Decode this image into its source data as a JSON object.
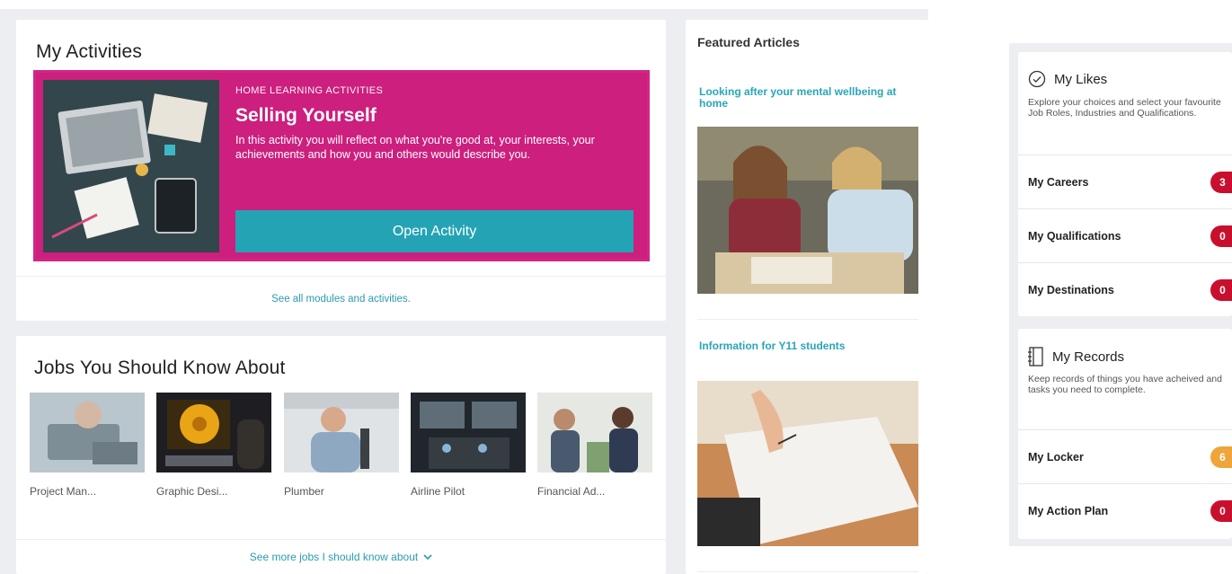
{
  "activities": {
    "title": "My Activities",
    "hero": {
      "kicker": "HOME LEARNING ACTIVITIES",
      "title": "Selling Yourself",
      "description": "In this activity you will reflect on what you're good at, your interests, your achievements and how you and others would describe you.",
      "button_label": "Open Activity",
      "color": "#cc1f7e"
    },
    "see_all_label": "See all modules and activities."
  },
  "jobs": {
    "title": "Jobs You Should Know About",
    "items": [
      {
        "label": "Project Man..."
      },
      {
        "label": "Graphic Desi..."
      },
      {
        "label": "Plumber"
      },
      {
        "label": "Airline Pilot"
      },
      {
        "label": "Financial Ad..."
      }
    ],
    "see_more_label": "See more jobs I should know about",
    "see_more_icon": "chevron-down-icon"
  },
  "featured": {
    "title": "Featured Articles",
    "articles": [
      {
        "title": "Looking after your mental wellbeing at home"
      },
      {
        "title": "Information for Y11 students"
      }
    ]
  },
  "likes": {
    "title": "My Likes",
    "icon": "check-circle-icon",
    "description": "Explore your choices and select your favourite Job Roles, Industries and Qualifications.",
    "rows": [
      {
        "label": "My Careers",
        "count": "3",
        "color": "#c8102e"
      },
      {
        "label": "My Qualifications",
        "count": "0",
        "color": "#c8102e"
      },
      {
        "label": "My Destinations",
        "count": "0",
        "color": "#c8102e"
      }
    ]
  },
  "records": {
    "title": "My Records",
    "icon": "notebook-icon",
    "description": "Keep records of things you have acheived and tasks you need to complete.",
    "rows": [
      {
        "label": "My Locker",
        "count": "6",
        "color": "#f0a53a"
      },
      {
        "label": "My Action Plan",
        "count": "0",
        "color": "#c8102e"
      }
    ]
  },
  "colors": {
    "accent": "#24a3b5",
    "link": "#2a9bb0",
    "badge_red": "#c8102e",
    "badge_orange": "#f0a53a"
  }
}
